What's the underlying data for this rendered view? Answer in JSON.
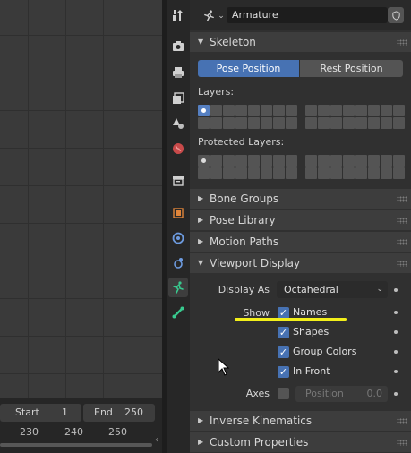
{
  "header": {
    "object_name": "Armature"
  },
  "skeleton": {
    "title": "Skeleton",
    "pose_position_label": "Pose Position",
    "rest_position_label": "Rest Position",
    "layers_label": "Layers:",
    "protected_layers_label": "Protected Layers:"
  },
  "panels": {
    "bone_groups": "Bone Groups",
    "pose_library": "Pose Library",
    "motion_paths": "Motion Paths",
    "viewport_display": "Viewport Display",
    "inverse_kinematics": "Inverse Kinematics",
    "custom_properties": "Custom Properties"
  },
  "viewport_display": {
    "display_as_label": "Display As",
    "display_as_value": "Octahedral",
    "show_label": "Show",
    "names_label": "Names",
    "names_checked": true,
    "shapes_label": "Shapes",
    "shapes_checked": true,
    "group_colors_label": "Group Colors",
    "group_colors_checked": true,
    "in_front_label": "In Front",
    "in_front_checked": true,
    "axes_label": "Axes",
    "axes_checked": false,
    "position_label": "Position",
    "position_value": "0.0"
  },
  "timeline": {
    "start_label": "Start",
    "start_value": "1",
    "end_label": "End",
    "end_value": "250",
    "frame_ticks": [
      "230",
      "240",
      "250"
    ]
  },
  "tabs": [
    {
      "name": "tool-tab",
      "icon": "wrench-screwdriver-icon",
      "active": false
    },
    {
      "name": "render-tab",
      "icon": "camera-back-icon",
      "active": false
    },
    {
      "name": "output-tab",
      "icon": "printer-icon",
      "active": false
    },
    {
      "name": "view-layer-tab",
      "icon": "image-stack-icon",
      "active": false
    },
    {
      "name": "scene-tab",
      "icon": "cone-sphere-icon",
      "active": false
    },
    {
      "name": "world-tab",
      "icon": "globe-icon",
      "active": false
    },
    {
      "name": "collection-tab",
      "icon": "box-icon",
      "active": false
    },
    {
      "name": "object-tab",
      "icon": "orange-square-icon",
      "active": false
    },
    {
      "name": "modifiers-tab",
      "icon": "blue-circle-icon",
      "active": false
    },
    {
      "name": "physics-tab",
      "icon": "orbit-icon",
      "active": false
    },
    {
      "name": "armature-data-tab",
      "icon": "running-figure-icon",
      "active": true
    },
    {
      "name": "bone-tab",
      "icon": "bone-icon",
      "active": false
    }
  ],
  "colors": {
    "accent_blue": "#4772b3",
    "highlight_yellow": "#f2ef1a",
    "armature_green": "#38c98e"
  }
}
